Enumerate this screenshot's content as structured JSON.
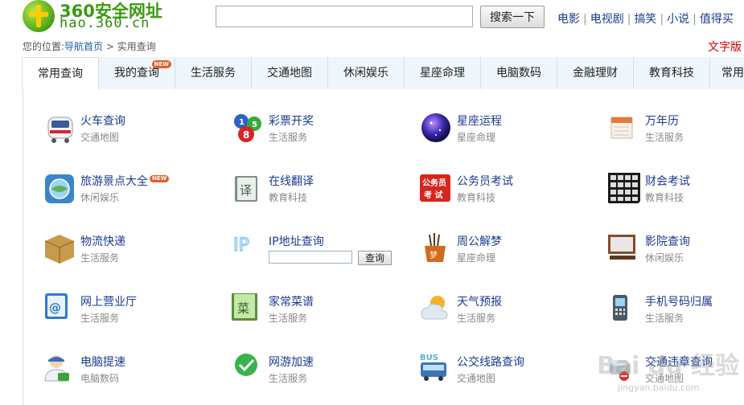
{
  "header": {
    "logo_title": "360安全网址",
    "logo_domain": "hao.360.cn",
    "search_placeholder": "",
    "search_button": "搜索一下",
    "top_links": [
      "电影",
      "电视剧",
      "搞笑",
      "小说",
      "值得买"
    ],
    "text_version": "文字版"
  },
  "breadcrumb": {
    "prefix": "您的位置:",
    "home": "导航首页",
    "separator": ">",
    "current": "实用查询"
  },
  "tabs": [
    {
      "label": "常用查询",
      "active": true
    },
    {
      "label": "我的查询",
      "badge": "NEW"
    },
    {
      "label": "生活服务"
    },
    {
      "label": "交通地图"
    },
    {
      "label": "休闲娱乐"
    },
    {
      "label": "星座命理"
    },
    {
      "label": "电脑数码"
    },
    {
      "label": "金融理财"
    },
    {
      "label": "教育科技"
    },
    {
      "label": "常用"
    }
  ],
  "items": [
    {
      "name": "火车查询",
      "category": "交通地图",
      "icon": "train-icon"
    },
    {
      "name": "彩票开奖",
      "category": "生活服务",
      "icon": "lottery-balls-icon"
    },
    {
      "name": "星座运程",
      "category": "星座命理",
      "icon": "constellation-orb-icon"
    },
    {
      "name": "万年历",
      "category": "生活服务",
      "icon": "calendar-icon"
    },
    {
      "name": "旅游景点大全",
      "category": "休闲娱乐",
      "icon": "travel-globe-icon",
      "badge": "NEW"
    },
    {
      "name": "在线翻译",
      "category": "教育科技",
      "icon": "translate-book-icon",
      "icon_text": "译"
    },
    {
      "name": "公务员考试",
      "category": "教育科技",
      "icon": "civil-exam-icon",
      "icon_text_1": "公务员",
      "icon_text_2": "考 试"
    },
    {
      "name": "财会考试",
      "category": "教育科技",
      "icon": "calculator-icon"
    },
    {
      "name": "物流快递",
      "category": "生活服务",
      "icon": "package-box-icon"
    },
    {
      "name": "IP地址查询",
      "category": "",
      "icon": "ip-icon",
      "icon_text": "IP",
      "button": "查询"
    },
    {
      "name": "周公解梦",
      "category": "星座命理",
      "icon": "dream-pot-icon",
      "icon_text": "梦"
    },
    {
      "name": "影院查询",
      "category": "休闲娱乐",
      "icon": "cinema-screen-icon"
    },
    {
      "name": "网上营业厅",
      "category": "生活服务",
      "icon": "address-book-icon"
    },
    {
      "name": "家常菜谱",
      "category": "生活服务",
      "icon": "recipe-book-icon",
      "icon_text": "菜"
    },
    {
      "name": "天气预报",
      "category": "生活服务",
      "icon": "weather-sun-cloud-icon"
    },
    {
      "name": "手机号码归属",
      "category": "生活服务",
      "icon": "mobile-phone-icon"
    },
    {
      "name": "电脑提速",
      "category": "电脑数码",
      "icon": "computer-doctor-icon"
    },
    {
      "name": "网游加速",
      "category": "生活服务",
      "icon": "game-speedup-icon"
    },
    {
      "name": "公交线路查询",
      "category": "交通地图",
      "icon": "bus-icon",
      "icon_text": "BUS"
    },
    {
      "name": "交通违章查询",
      "category": "交通地图",
      "icon": "traffic-violation-icon"
    }
  ],
  "watermark": {
    "text": "Bai du 经验",
    "url": "jingyan.baidu.com"
  },
  "colors": {
    "link_blue": "#1a3a8c",
    "logo_green": "#3c9a12",
    "tab_border": "#cfe0ec",
    "tab_bg": "#eef6fb",
    "new_badge": "#e0602a",
    "text_version_red": "#cc0000"
  }
}
